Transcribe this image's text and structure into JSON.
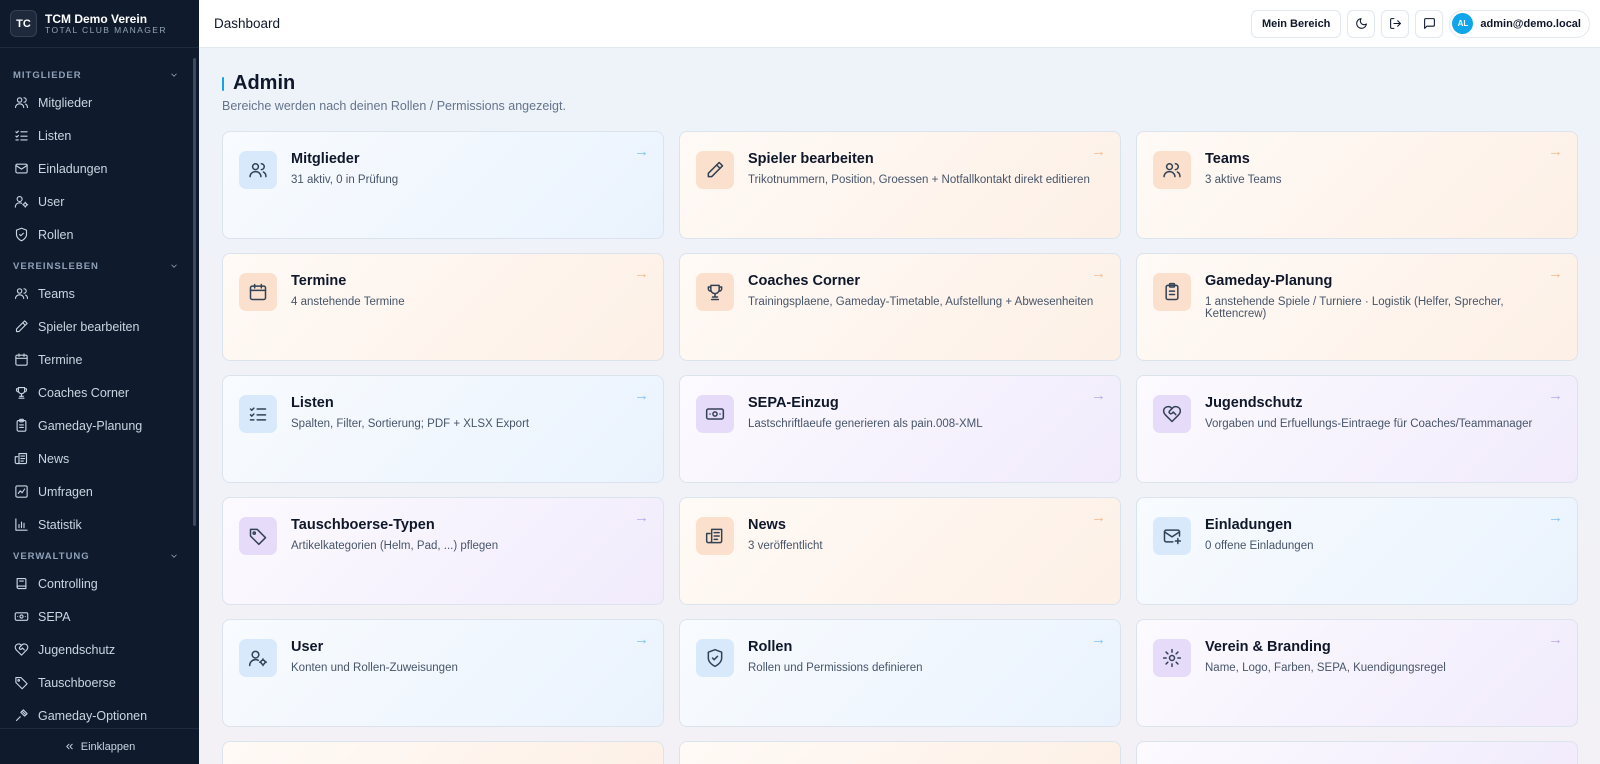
{
  "brand": {
    "logo": "TC",
    "name": "TCM Demo Verein",
    "subtitle": "TOTAL CLUB MANAGER"
  },
  "sidebar": {
    "sections": [
      {
        "title": "MITGLIEDER",
        "items": [
          {
            "label": "Mitglieder",
            "icon": "users-icon"
          },
          {
            "label": "Listen",
            "icon": "list-checks-icon"
          },
          {
            "label": "Einladungen",
            "icon": "mail-icon"
          },
          {
            "label": "User",
            "icon": "user-cog-icon"
          },
          {
            "label": "Rollen",
            "icon": "shield-icon"
          }
        ]
      },
      {
        "title": "VEREINSLEBEN",
        "items": [
          {
            "label": "Teams",
            "icon": "users-icon"
          },
          {
            "label": "Spieler bearbeiten",
            "icon": "pencil-icon"
          },
          {
            "label": "Termine",
            "icon": "calendar-icon"
          },
          {
            "label": "Coaches Corner",
            "icon": "trophy-icon"
          },
          {
            "label": "Gameday-Planung",
            "icon": "clipboard-icon"
          },
          {
            "label": "News",
            "icon": "newspaper-icon"
          },
          {
            "label": "Umfragen",
            "icon": "poll-icon"
          },
          {
            "label": "Statistik",
            "icon": "bar-chart-icon"
          }
        ]
      },
      {
        "title": "VERWALTUNG",
        "items": [
          {
            "label": "Controlling",
            "icon": "book-icon"
          },
          {
            "label": "SEPA",
            "icon": "banknote-icon"
          },
          {
            "label": "Jugendschutz",
            "icon": "heart-handshake-icon"
          },
          {
            "label": "Tauschboerse",
            "icon": "tag-icon"
          },
          {
            "label": "Gameday-Optionen",
            "icon": "settings-icon"
          }
        ]
      }
    ],
    "collapse_label": "Einklappen"
  },
  "header": {
    "title": "Dashboard",
    "mein_bereich": "Mein Bereich",
    "user_initials": "AL",
    "user_email": "admin@demo.local"
  },
  "page": {
    "title": "Admin",
    "subtitle": "Bereiche werden nach deinen Rollen / Permissions angezeigt."
  },
  "cards": [
    {
      "title": "Mitglieder",
      "desc": "31 aktiv, 0 in Prüfung",
      "tone": "blue",
      "icon": "users-icon"
    },
    {
      "title": "Spieler bearbeiten",
      "desc": "Trikotnummern, Position, Groessen + Notfallkontakt direkt editieren",
      "tone": "orange",
      "icon": "pencil-icon"
    },
    {
      "title": "Teams",
      "desc": "3 aktive Teams",
      "tone": "orange",
      "icon": "users-icon"
    },
    {
      "title": "Termine",
      "desc": "4 anstehende Termine",
      "tone": "orange",
      "icon": "calendar-icon"
    },
    {
      "title": "Coaches Corner",
      "desc": "Trainingsplaene, Gameday-Timetable, Aufstellung + Abwesenheiten",
      "tone": "orange",
      "icon": "trophy-icon"
    },
    {
      "title": "Gameday-Planung",
      "desc": "1 anstehende Spiele / Turniere · Logistik (Helfer, Sprecher, Kettencrew)",
      "tone": "orange",
      "icon": "clipboard-icon"
    },
    {
      "title": "Listen",
      "desc": "Spalten, Filter, Sortierung; PDF + XLSX Export",
      "tone": "blue",
      "icon": "list-checks-icon"
    },
    {
      "title": "SEPA-Einzug",
      "desc": "Lastschriftlaeufe generieren als pain.008-XML",
      "tone": "purple",
      "icon": "banknote-icon"
    },
    {
      "title": "Jugendschutz",
      "desc": "Vorgaben und Erfuellungs-Eintraege für Coaches/Teammanager",
      "tone": "purple",
      "icon": "heart-handshake-icon"
    },
    {
      "title": "Tauschboerse-Typen",
      "desc": "Artikelkategorien (Helm, Pad, ...) pflegen",
      "tone": "purple",
      "icon": "tag-icon"
    },
    {
      "title": "News",
      "desc": "3 veröffentlicht",
      "tone": "orange",
      "icon": "newspaper-icon"
    },
    {
      "title": "Einladungen",
      "desc": "0 offene Einladungen",
      "tone": "blue",
      "icon": "mail-plus-icon"
    },
    {
      "title": "User",
      "desc": "Konten und Rollen-Zuweisungen",
      "tone": "blue",
      "icon": "user-cog-icon"
    },
    {
      "title": "Rollen",
      "desc": "Rollen und Permissions definieren",
      "tone": "blue",
      "icon": "shield-icon"
    },
    {
      "title": "Verein & Branding",
      "desc": "Name, Logo, Farben, SEPA, Kuendigungsregel",
      "tone": "purple",
      "icon": "gear-icon"
    }
  ],
  "partial_cards": [
    {
      "tone": "orange"
    },
    {
      "tone": "orange"
    },
    {
      "tone": "purple"
    }
  ],
  "arrow": "→"
}
